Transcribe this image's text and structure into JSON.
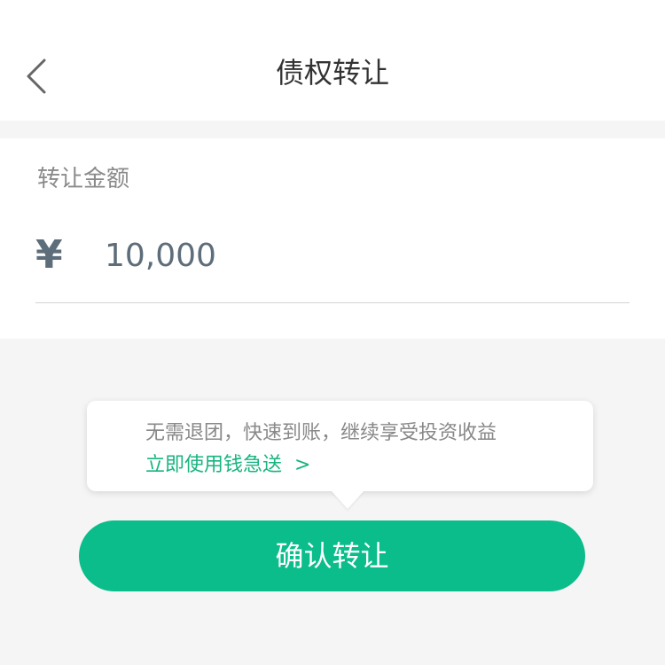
{
  "nav": {
    "title": "债权转让",
    "back_icon": "chevron-left-icon"
  },
  "form": {
    "label": "转让金额",
    "currency_symbol": "¥",
    "amount_value": "10,000"
  },
  "tooltip": {
    "text": "无需退团，快速到账，继续享受投资收益",
    "link_label": "立即使用钱急送",
    "link_chevron": ">"
  },
  "confirm": {
    "label": "确认转让"
  },
  "colors": {
    "accent": "#0bbd8b",
    "link": "#17b47e",
    "page_bg": "#f4f5f4"
  }
}
